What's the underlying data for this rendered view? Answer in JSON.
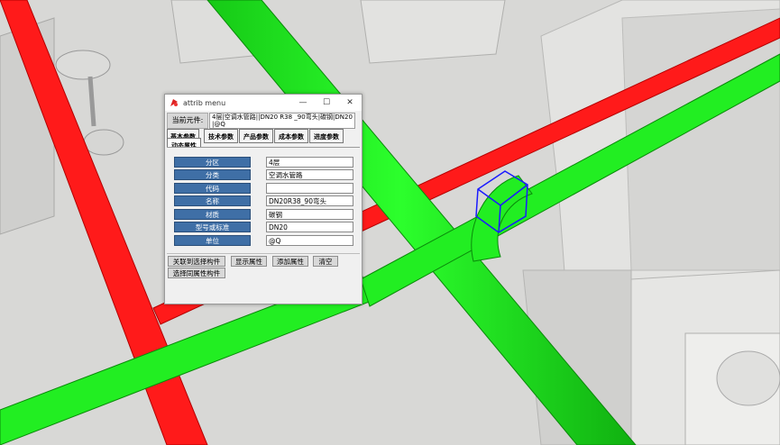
{
  "window": {
    "title": "attrib menu",
    "current_component_label": "当前元件:",
    "current_component_value": "4层|空调水管路||DN20 R38 _90弯头|碳钢|DN20|@Q"
  },
  "tabs": [
    {
      "label": "基本参数"
    },
    {
      "label": "技术参数"
    },
    {
      "label": "产品参数"
    },
    {
      "label": "成本参数"
    },
    {
      "label": "进度参数"
    },
    {
      "label": "动态属性",
      "active": true
    }
  ],
  "fields": [
    {
      "label": "分区",
      "value": "4层"
    },
    {
      "label": "分类",
      "value": "空调水管路"
    },
    {
      "label": "代码",
      "value": ""
    },
    {
      "label": "名称",
      "value": "DN20R38_90弯头"
    },
    {
      "label": "材质",
      "value": "碳钢"
    },
    {
      "label": "型号或标准",
      "value": "DN20"
    },
    {
      "label": "单位",
      "value": "@Q"
    }
  ],
  "buttons": {
    "link_selected": "关联到选择构件",
    "show_attrs": "显示属性",
    "add_attr": "添加属性",
    "clear": "清空",
    "select_same": "选择同属性构件"
  },
  "colors": {
    "red_pipe": "#ff1a1a",
    "green_pipe": "#1aff1a",
    "field_label_bg": "#3f6fa6",
    "selection_box": "#1a1aff"
  }
}
